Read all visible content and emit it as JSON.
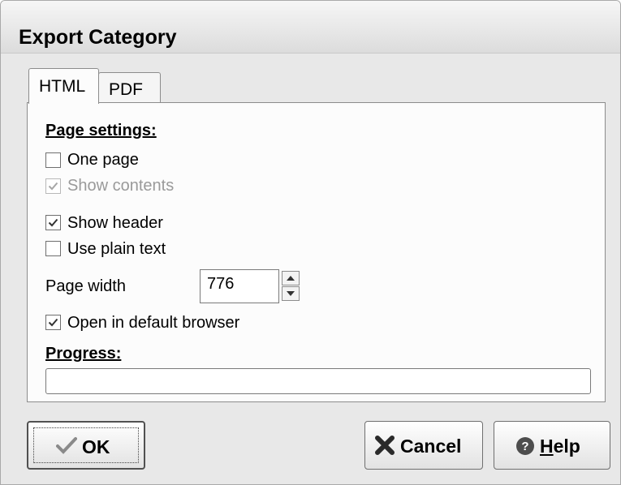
{
  "window": {
    "title": "Export Category"
  },
  "tabs": [
    {
      "label": "HTML",
      "active": true
    },
    {
      "label": "PDF",
      "active": false
    }
  ],
  "page_settings": {
    "heading": "Page settings:",
    "one_page": {
      "label": "One page",
      "checked": false,
      "enabled": true
    },
    "show_contents": {
      "label": "Show contents",
      "checked": true,
      "enabled": false
    },
    "show_header": {
      "label": "Show header",
      "checked": true,
      "enabled": true
    },
    "use_plain_text": {
      "label": "Use plain text",
      "checked": false,
      "enabled": true
    },
    "page_width": {
      "label": "Page width",
      "value": "776"
    },
    "open_in_browser": {
      "label": "Open in default browser",
      "checked": true,
      "enabled": true
    }
  },
  "progress": {
    "heading": "Progress:",
    "percent": 0
  },
  "buttons": {
    "ok": {
      "label": "OK",
      "icon": "checkmark-icon"
    },
    "cancel": {
      "label": "Cancel",
      "icon": "x-icon"
    },
    "help": {
      "label": "Help",
      "icon": "help-icon"
    }
  }
}
